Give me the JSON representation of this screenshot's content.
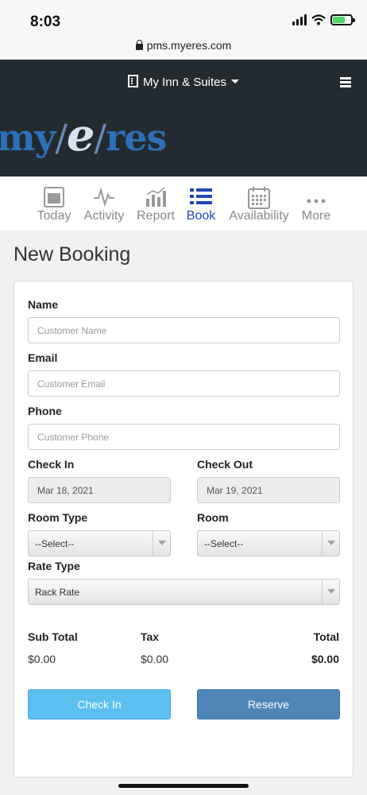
{
  "status_bar": {
    "time": "8:03",
    "url": "pms.myeres.com"
  },
  "header": {
    "property_name": "My Inn & Suites",
    "logo": {
      "left": "my",
      "mid": "e",
      "right": "res"
    }
  },
  "tabs": [
    {
      "label": "Today",
      "icon": "calendar-day-icon",
      "active": false
    },
    {
      "label": "Activity",
      "icon": "pulse-icon",
      "active": false
    },
    {
      "label": "Report",
      "icon": "bar-chart-icon",
      "active": false
    },
    {
      "label": "Book",
      "icon": "list-icon",
      "active": true
    },
    {
      "label": "Availability",
      "icon": "calendar-grid-icon",
      "active": false
    },
    {
      "label": "More",
      "icon": "ellipsis-icon",
      "active": false
    }
  ],
  "page": {
    "title": "New Booking"
  },
  "form": {
    "name_label": "Name",
    "name_placeholder": "Customer Name",
    "email_label": "Email",
    "email_placeholder": "Customer Email",
    "phone_label": "Phone",
    "phone_placeholder": "Customer Phone",
    "checkin_label": "Check In",
    "checkin_value": "Mar 18, 2021",
    "checkout_label": "Check Out",
    "checkout_value": "Mar 19, 2021",
    "room_type_label": "Room Type",
    "room_type_value": "--Select--",
    "room_label": "Room",
    "room_value": "--Select--",
    "rate_type_label": "Rate Type",
    "rate_type_value": "Rack Rate"
  },
  "totals": {
    "subtotal_label": "Sub Total",
    "subtotal_value": "$0.00",
    "tax_label": "Tax",
    "tax_value": "$0.00",
    "total_label": "Total",
    "total_value": "$0.00"
  },
  "buttons": {
    "checkin": "Check In",
    "reserve": "Reserve"
  },
  "colors": {
    "header_bg": "#242b30",
    "active_tab": "#2346b8",
    "checkin_btn": "#5bc0ef",
    "reserve_btn": "#4f86b9"
  }
}
